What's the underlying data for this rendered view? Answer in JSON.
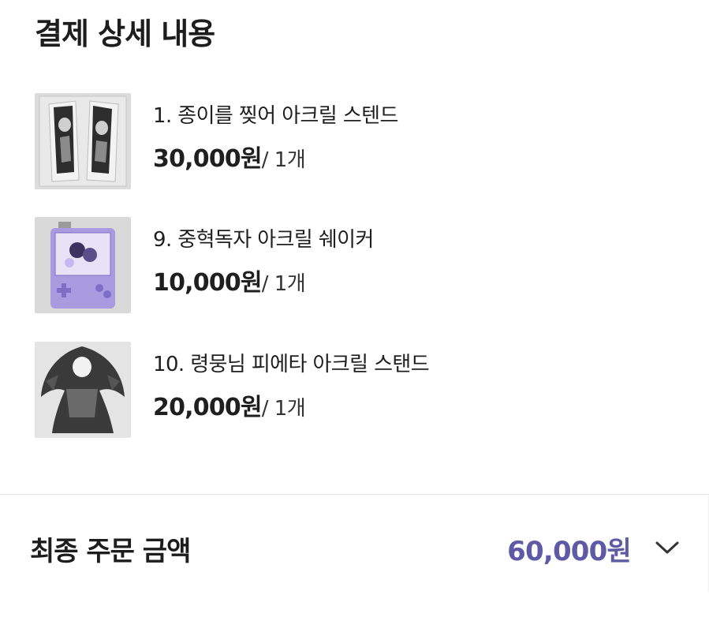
{
  "page": {
    "title": "결제 상세 내용"
  },
  "items": [
    {
      "name": "1. 종이를 찢어 아크릴 스텐드",
      "price": "30,000원",
      "qty": "/ 1개",
      "thumbnail_icon": "acrylic-stand-photo"
    },
    {
      "name": "9. 중혁독자 아크릴 쉐이커",
      "price": "10,000원",
      "qty": "/ 1개",
      "thumbnail_icon": "acrylic-shaker-photo"
    },
    {
      "name": "10. 령뭉님 피에타 아크릴 스탠드",
      "price": "20,000원",
      "qty": "/ 1개",
      "thumbnail_icon": "acrylic-stand-photo"
    }
  ],
  "total": {
    "label": "최종 주문 금액",
    "amount": "60,000원",
    "toggle_icon": "chevron-down-icon"
  },
  "colors": {
    "accent": "#5e5aa6",
    "text": "#1f1f1f",
    "divider": "#e4e4e4"
  }
}
